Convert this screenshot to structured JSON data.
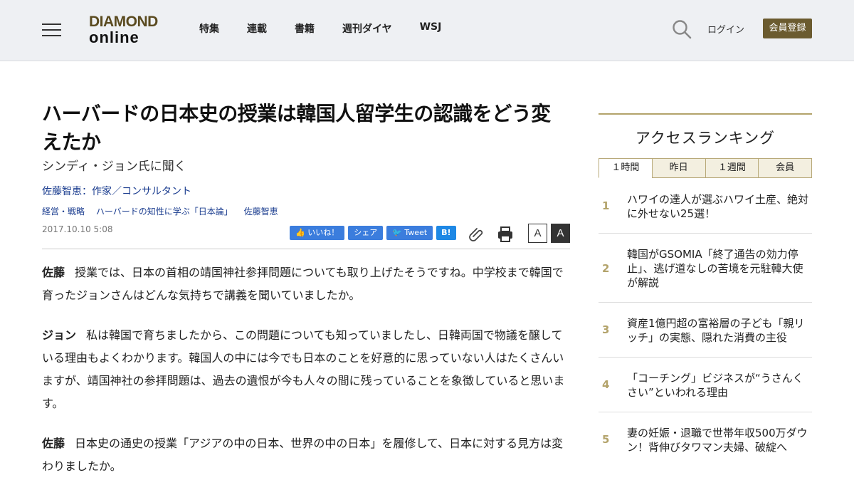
{
  "header": {
    "logo_line1": "DIAMOND",
    "logo_line2": "online",
    "nav": [
      "特集",
      "連載",
      "書籍",
      "週刊ダイヤ",
      "WSJ"
    ],
    "login": "ログイン",
    "register": "会員登録"
  },
  "article": {
    "title": "ハーバードの日本史の授業は韓国人留学生の認識をどう変えたか",
    "subtitle": "シンディ・ジョン氏に聞く",
    "author": "佐藤智恵：作家／コンサルタント",
    "tags": [
      "経営・戦略",
      "ハーバードの知性に学ぶ「日本論」",
      "佐藤智恵"
    ],
    "date": "2017.10.10 5:08",
    "share": {
      "like": "いいね！",
      "share": "シェア",
      "tweet": "Tweet",
      "hatena": "B!"
    },
    "font_small": "A",
    "font_large": "A",
    "paragraphs": [
      {
        "speaker": "佐藤",
        "text": "授業では、日本の首相の靖国神社参拝問題についても取り上げたそうですね。中学校まで韓国で育ったジョンさんはどんな気持ちで講義を聞いていましたか。"
      },
      {
        "speaker": "ジョン",
        "text": "私は韓国で育ちましたから、この問題についても知っていましたし、日韓両国で物議を醸している理由もよくわかります。韓国人の中には今でも日本のことを好意的に思っていない人はたくさんいますが、靖国神社の参拝問題は、過去の遺恨が今も人々の間に残っていることを象徴していると思います。"
      },
      {
        "speaker": "佐藤",
        "text": "日本史の通史の授業「アジアの中の日本、世界の中の日本」を履修して、日本に対する見方は変わりましたか。"
      }
    ]
  },
  "sidebar": {
    "title": "アクセスランキング",
    "tabs": [
      "１時間",
      "昨日",
      "１週間",
      "会員"
    ],
    "items": [
      {
        "num": "1",
        "text": "ハワイの達人が選ぶハワイ土産、絶対に外せない25選！"
      },
      {
        "num": "2",
        "text": "韓国がGSOMIA「終了通告の効力停止」、逃げ道なしの苦境を元駐韓大使が解説"
      },
      {
        "num": "3",
        "text": "資産1億円超の富裕層の子ども「親リッチ」の実態、隠れた消費の主役"
      },
      {
        "num": "4",
        "text": "「コーチング」ビジネスが“うさんくさい”といわれる理由"
      },
      {
        "num": "5",
        "text": "妻の妊娠・退職で世帯年収500万ダウン！背伸びタワマン夫婦、破綻へ"
      }
    ]
  }
}
